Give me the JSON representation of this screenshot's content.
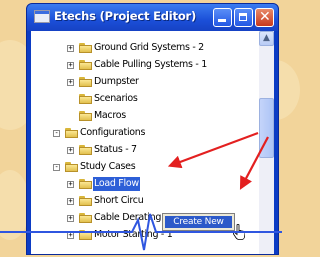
{
  "window": {
    "title": "Etechs (Project Editor)"
  },
  "tree": [
    {
      "label": "Ground Grid Systems - 2",
      "expander": "+"
    },
    {
      "label": "Cable Pulling Systems - 1",
      "expander": "+"
    },
    {
      "label": "Dumpster",
      "expander": "+"
    },
    {
      "label": "Scenarios",
      "expander": ""
    },
    {
      "label": "Macros",
      "expander": ""
    },
    {
      "label": "Configurations",
      "expander": "-"
    },
    {
      "label": "Status - 7",
      "expander": "+"
    },
    {
      "label": "Study Cases",
      "expander": "-"
    },
    {
      "label": "Load Flow",
      "expander": "+"
    },
    {
      "label": "Short Circu",
      "expander": "+"
    },
    {
      "label": "Cable Derating",
      "expander": "+"
    },
    {
      "label": "Motor Starting - 1",
      "expander": "+"
    }
  ],
  "context_menu": {
    "items": [
      {
        "label": "Create New"
      }
    ]
  },
  "colors": {
    "titlebar": "#1b4fd8",
    "selection": "#2d5fd7",
    "annotation_arrow": "#e32020",
    "annotation_line": "#2f56e0"
  },
  "icons": {
    "folder": "folder-icon",
    "cursor": "pointer-hand-icon",
    "minimize": "minimize-icon",
    "maximize": "maximize-icon",
    "close": "close-icon"
  }
}
